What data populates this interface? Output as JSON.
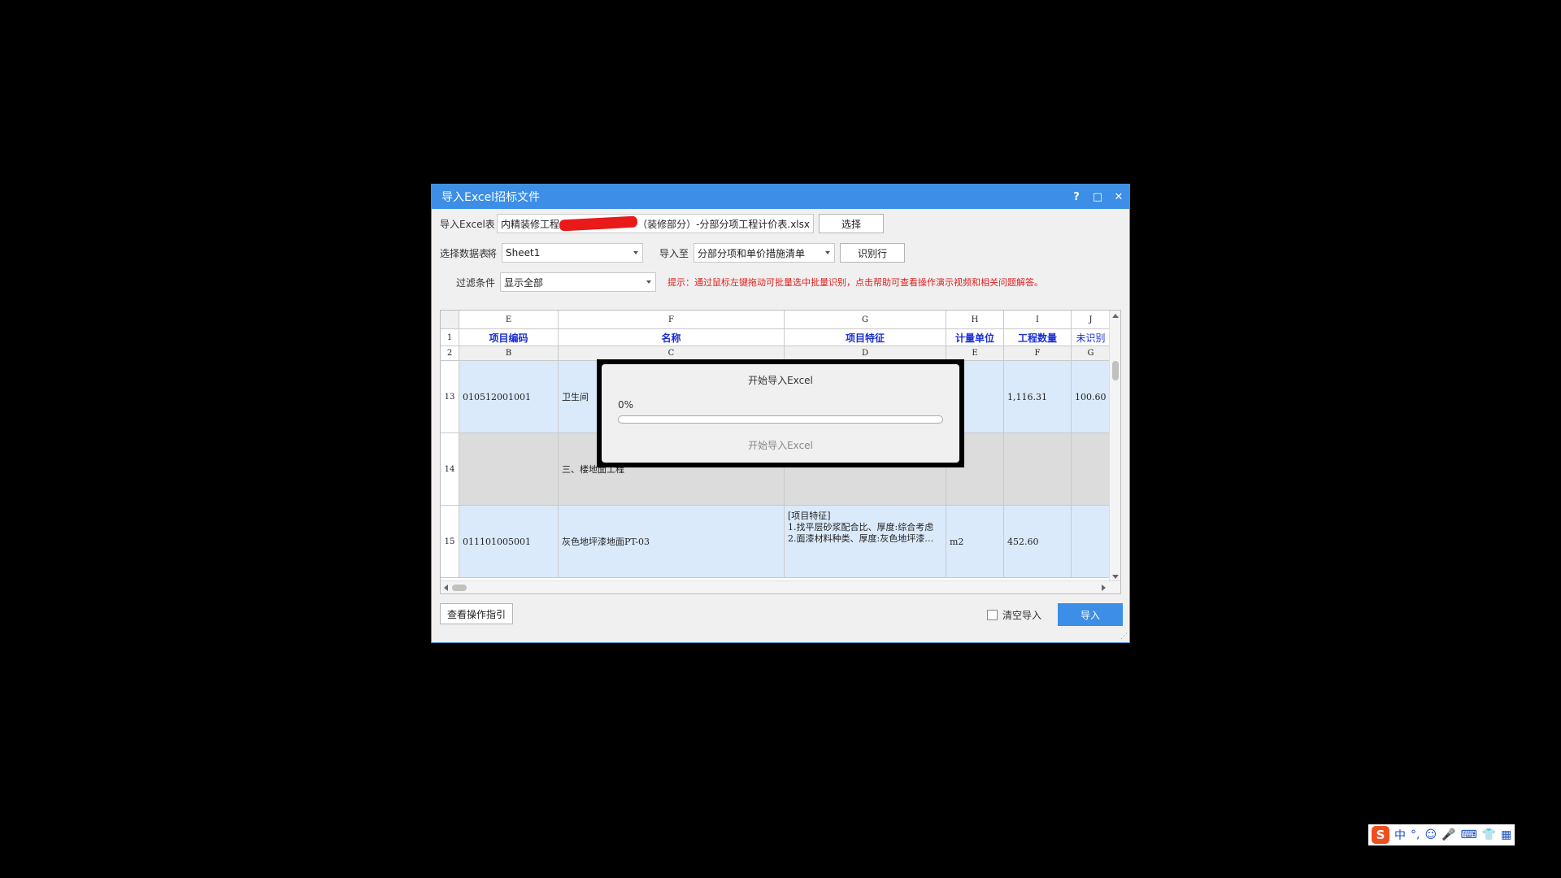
{
  "window": {
    "title": "导入Excel招标文件",
    "help": "?",
    "maximize": "□",
    "close": "✕"
  },
  "form": {
    "excel_label": "导入Excel表",
    "excel_path_start": "内精装修工程",
    "excel_path_end": "（装修部分）-分部分项工程计价表.xlsx",
    "select_btn": "选择",
    "sheet_label": "选择数据表",
    "sheet_prefix": "将",
    "sheet_value": "Sheet1",
    "import_to_label": "导入至",
    "import_to_value": "分部分项和单价措施清单",
    "identify_btn": "识别行",
    "filter_label": "过滤条件",
    "filter_value": "显示全部",
    "hint": "提示：通过鼠标左键拖动可批量选中批量识别，点击帮助可查看操作演示视频和相关问题解答。"
  },
  "grid": {
    "col_letters": [
      "E",
      "F",
      "G",
      "H",
      "I",
      "J"
    ],
    "row1_num": "1",
    "row1": [
      "项目编码",
      "名称",
      "项目特征",
      "计量单位",
      "工程数量",
      "未识别"
    ],
    "row2_num": "2",
    "row2": [
      "B",
      "C",
      "D",
      "E",
      "F",
      "G"
    ],
    "rows": [
      {
        "num": "13",
        "code": "010512001001",
        "name": "卫生间",
        "feature": "",
        "unit": "",
        "qty": "1,116.31",
        "extra": "100.60"
      },
      {
        "num": "14",
        "code": "",
        "name": "三、楼地面工程",
        "feature": "",
        "unit": "",
        "qty": "",
        "extra": ""
      },
      {
        "num": "15",
        "code": "011101005001",
        "name": "灰色地坪漆地面PT-03",
        "feature": "[项目特征]\n1.找平层砂浆配合比、厚度:综合考虑\n2.面漆材料种类、厚度:灰色地坪漆…",
        "unit": "m2",
        "qty": "452.60",
        "extra": ""
      }
    ]
  },
  "progress": {
    "title": "开始导入Excel",
    "percent_label": "0%",
    "percent": 0,
    "status": "开始导入Excel"
  },
  "footer": {
    "guide_btn": "查看操作指引",
    "clear_label": "清空导入",
    "import_btn": "导入"
  },
  "ime": {
    "logo": "S",
    "lang": "中",
    "punct": "°,",
    "emoji": "☺",
    "mic": "🎤",
    "keyboard": "⌨",
    "skin": "👕",
    "tools": "▦"
  },
  "colors": {
    "accent": "#3c8ee6",
    "hint": "#e02020",
    "header_text": "#1a2fd6",
    "row_blue": "#dbeafb",
    "row_gray": "#dcdcdc"
  }
}
